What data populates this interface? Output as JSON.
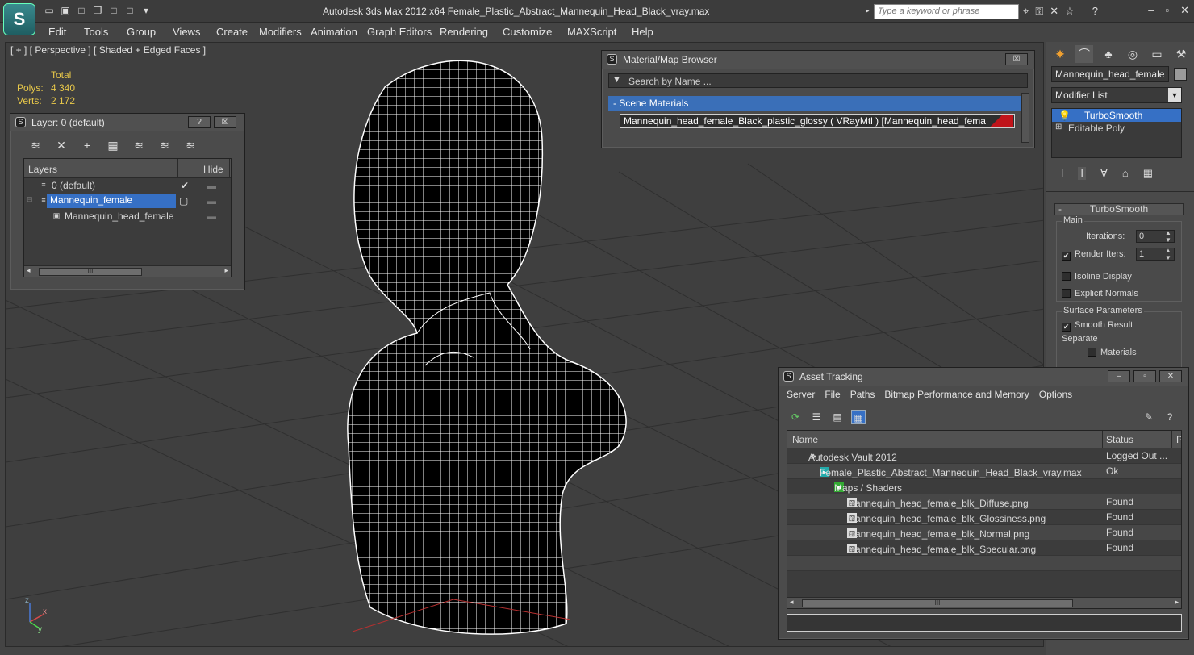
{
  "app": {
    "window_title": "Autodesk 3ds Max  2012 x64      Female_Plastic_Abstract_Mannequin_Head_Black_vray.max",
    "search_placeholder": "Type a keyword or phrase"
  },
  "menu": [
    "Edit",
    "Tools",
    "Group",
    "Views",
    "Create",
    "Modifiers",
    "Animation",
    "Graph Editors",
    "Rendering",
    "Customize",
    "MAXScript",
    "Help"
  ],
  "viewport": {
    "label": "[ + ] [ Perspective ] [ Shaded + Edged Faces ]",
    "stats": {
      "header": "Total",
      "polys_label": "Polys:",
      "polys_value": "4 340",
      "verts_label": "Verts:",
      "verts_value": "2 172"
    },
    "axis": {
      "x": "x",
      "y": "y",
      "z": "z"
    }
  },
  "layer_panel": {
    "title": "Layer: 0 (default)",
    "help_btn": "?",
    "close_btn": "☒",
    "columns": {
      "layers": "Layers",
      "hide": "Hide"
    },
    "rows": [
      {
        "name": "0 (default)"
      },
      {
        "name": "Mannequin_female"
      },
      {
        "name": "Mannequin_head_female"
      }
    ],
    "scroll_grip": "III"
  },
  "material_browser": {
    "title": "Material/Map Browser",
    "close_btn": "☒",
    "search_placeholder": "Search by Name ...",
    "group_label": "- Scene Materials",
    "material_item": "Mannequin_head_female_Black_plastic_glossy  ( VRayMtl )  [Mannequin_head_female]",
    "swatch_color": "#c0141a"
  },
  "command_panel": {
    "object_name": "Mannequin_head_female",
    "object_color": "#9a9a9a",
    "modifier_list_label": "Modifier List",
    "stack": [
      {
        "name": "TurboSmooth"
      },
      {
        "name": "Editable Poly"
      }
    ],
    "rollout_title": "TurboSmooth",
    "rollout_toggle": "-",
    "main_group": "Main",
    "iterations_label": "Iterations:",
    "iterations_value": "0",
    "render_iters_label": "Render Iters:",
    "render_iters_value": "1",
    "isoline_label": "Isoline Display",
    "explicit_normals_label": "Explicit Normals",
    "surface_group": "Surface Parameters",
    "smooth_result_label": "Smooth Result",
    "separate_label": "Separate",
    "materials_label": "Materials"
  },
  "asset_tracking": {
    "title": "Asset Tracking",
    "menu": [
      "Server",
      "File",
      "Paths",
      "Bitmap Performance and Memory",
      "Options"
    ],
    "columns": {
      "name": "Name",
      "status": "Status",
      "extra": "P"
    },
    "rows": [
      {
        "name": "Autodesk Vault 2012",
        "status": "Logged Out ..."
      },
      {
        "name": "Female_Plastic_Abstract_Mannequin_Head_Black_vray.max",
        "status": "Ok"
      },
      {
        "name": "Maps / Shaders",
        "status": ""
      },
      {
        "name": "mannequin_head_female_blk_Diffuse.png",
        "status": "Found"
      },
      {
        "name": "mannequin_head_female_blk_Glossiness.png",
        "status": "Found"
      },
      {
        "name": "mannequin_head_female_blk_Normal.png",
        "status": "Found"
      },
      {
        "name": "mannequin_head_female_blk_Specular.png",
        "status": "Found"
      }
    ],
    "scroll_grip": "III"
  },
  "colors": {
    "selection": "#3670c5",
    "stats_text": "#e8c84a",
    "wire": "#ffffff"
  },
  "icons": [
    "app-logo-icon",
    "new-icon",
    "open-icon",
    "save-icon",
    "undo-icon",
    "redo-icon",
    "binoculars-icon",
    "key-icon",
    "star-icon",
    "help-icon"
  ]
}
